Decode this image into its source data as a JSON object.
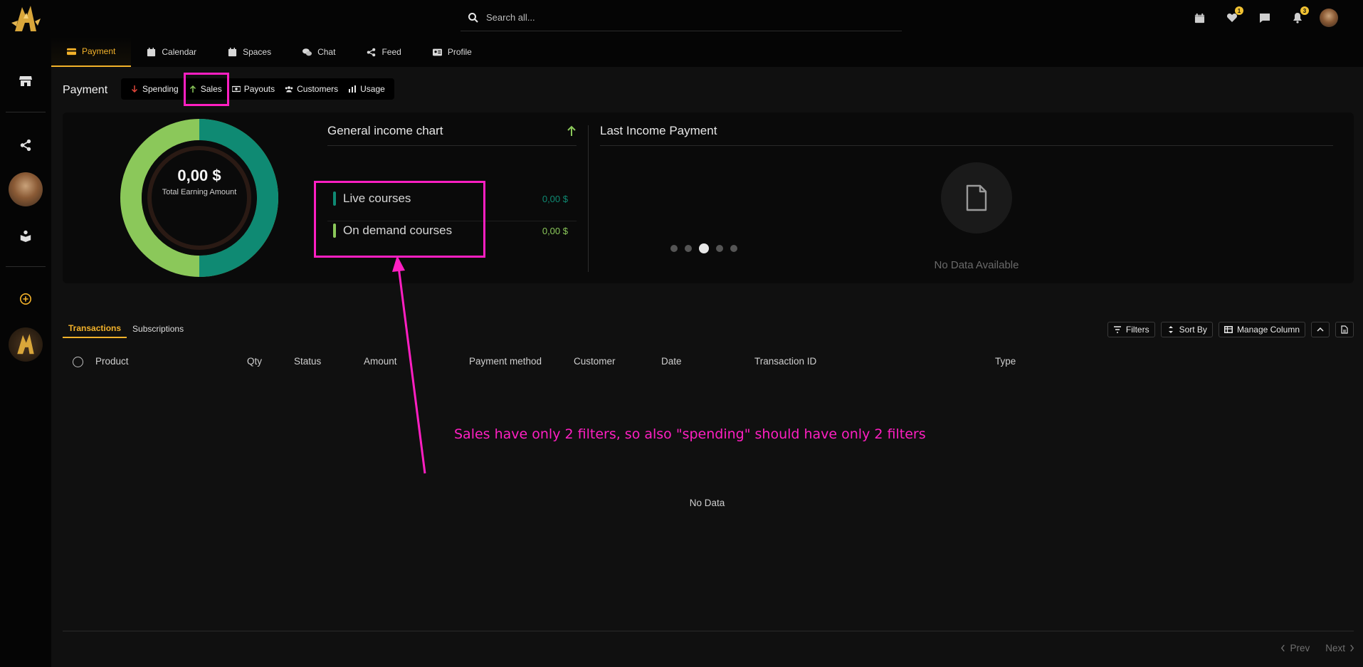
{
  "search": {
    "placeholder": "Search all..."
  },
  "header": {
    "badges": {
      "favorites": "1",
      "notifications": "3"
    }
  },
  "nav_tabs": [
    {
      "label": "Payment",
      "icon": "credit-card-icon"
    },
    {
      "label": "Calendar",
      "icon": "calendar-icon"
    },
    {
      "label": "Spaces",
      "icon": "calendar-icon"
    },
    {
      "label": "Chat",
      "icon": "chat-icon"
    },
    {
      "label": "Feed",
      "icon": "share-icon"
    },
    {
      "label": "Profile",
      "icon": "id-card-icon"
    }
  ],
  "payment": {
    "title": "Payment",
    "subtabs": [
      {
        "label": "Spending",
        "icon": "arrow-down-icon"
      },
      {
        "label": "Sales",
        "icon": "arrow-up-icon"
      },
      {
        "label": "Payouts",
        "icon": "money-icon"
      },
      {
        "label": "Customers",
        "icon": "users-icon"
      },
      {
        "label": "Usage",
        "icon": "bar-chart-icon"
      }
    ]
  },
  "donut": {
    "amount": "0,00 $",
    "label": "Total Earning Amount",
    "colors": {
      "primary": "#0f8a73",
      "secondary": "#8bc85a"
    }
  },
  "income_chart": {
    "title": "General income chart",
    "items": [
      {
        "name": "Live courses",
        "value": "0,00 $",
        "color": "#0f8a73"
      },
      {
        "name": "On demand courses",
        "value": "0,00 $",
        "color": "#8bc85a"
      }
    ]
  },
  "last_income": {
    "title": "Last Income Payment",
    "empty": "No Data Available"
  },
  "table_tabs": [
    "Transactions",
    "Subscriptions"
  ],
  "tools": {
    "filters": "Filters",
    "sort": "Sort By",
    "manage": "Manage Column"
  },
  "columns": [
    "Product",
    "Qty",
    "Status",
    "Amount",
    "Payment method",
    "Customer",
    "Date",
    "Transaction ID",
    "Type"
  ],
  "table_empty": "No Data",
  "pager": {
    "prev": "Prev",
    "next": "Next"
  },
  "annotation": {
    "text": "Sales have only 2 filters, so also \"spending\" should have only 2 filters",
    "color": "#ff1fc2"
  },
  "accent": "#f3b22a"
}
